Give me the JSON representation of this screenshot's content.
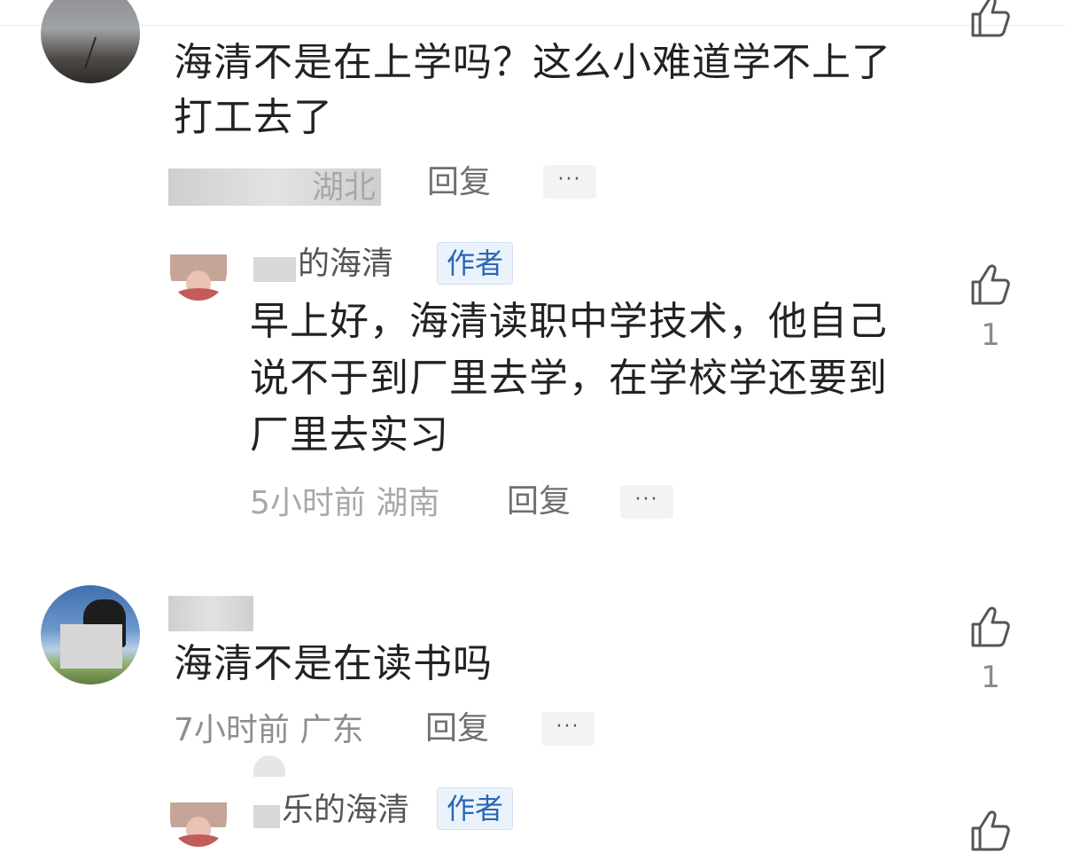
{
  "comments": [
    {
      "text_line1": "海清不是在上学吗？这么小难道学不上了",
      "text_line2": "打工去了",
      "meta": "湖北",
      "reply_label": "回复",
      "more_label": "···"
    },
    {
      "author": "的海清",
      "author_badge": "作者",
      "text_line1": "早上好，海清读职中学技术，他自己",
      "text_line2": "说不于到厂里去学，在学校学还要到",
      "text_line3": "厂里去实习",
      "meta": "5小时前 湖南",
      "reply_label": "回复",
      "more_label": "···",
      "likes": "1"
    },
    {
      "text": "海清不是在读书吗",
      "meta": "7小时前 广东",
      "reply_label": "回复",
      "more_label": "···",
      "likes": "1"
    },
    {
      "author": "乐的海清",
      "author_badge": "作者"
    }
  ],
  "colors": {
    "badge_text": "#2a67b3",
    "badge_bg": "#eaf2fb",
    "icon_gray": "#555555"
  },
  "icons": [
    "thumbs-up-icon"
  ]
}
